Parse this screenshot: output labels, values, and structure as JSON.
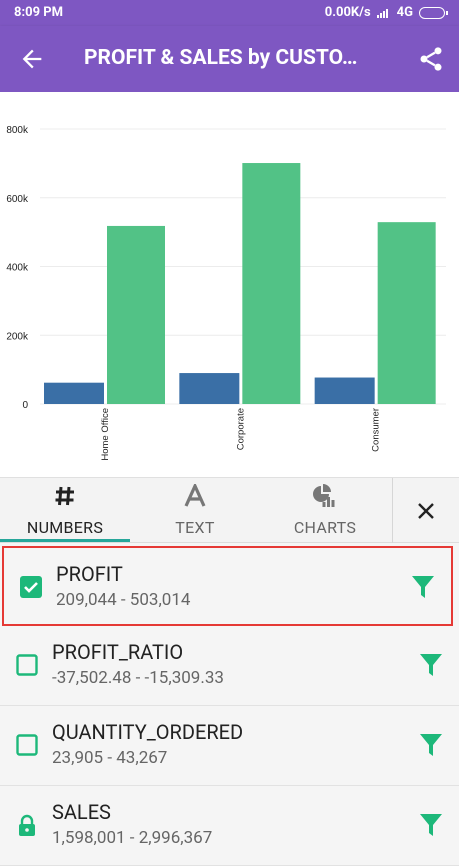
{
  "status_bar": {
    "time": "8:09 PM",
    "network_speed": "0.00K/s",
    "network_type": "4G"
  },
  "app_bar": {
    "title": "PROFIT & SALES by CUSTO…"
  },
  "chart_data": {
    "type": "bar",
    "categories": [
      "Home Office",
      "Corporate",
      "Consumer"
    ],
    "series": [
      {
        "color": "#3a6fa6",
        "values": [
          62000,
          90000,
          77000
        ]
      },
      {
        "color": "#52c286",
        "values": [
          518000,
          701000,
          529000
        ]
      }
    ],
    "ylim": [
      0,
      800000
    ],
    "yticks": [
      "0",
      "200k",
      "400k",
      "600k",
      "800k"
    ],
    "ytick_values": [
      0,
      200000,
      400000,
      600000,
      800000
    ],
    "grid": true
  },
  "tabs": [
    {
      "label": "NUMBERS",
      "icon": "hash-icon",
      "active": true
    },
    {
      "label": "TEXT",
      "icon": "text-a-icon",
      "active": false
    },
    {
      "label": "CHARTS",
      "icon": "pie-bar-chart-icon",
      "active": false
    }
  ],
  "fields": [
    {
      "name": "PROFIT",
      "range": "209,044 - 503,014",
      "state": "checked"
    },
    {
      "name": "PROFIT_RATIO",
      "range": "-37,502.48 - -15,309.33",
      "state": "unchecked"
    },
    {
      "name": "QUANTITY_ORDERED",
      "range": "23,905 - 43,267",
      "state": "unchecked"
    },
    {
      "name": "SALES",
      "range": "1,598,001 - 2,996,367",
      "state": "locked"
    }
  ],
  "colors": {
    "primary": "#7e57c2",
    "accent": "#26a69a",
    "filter": "#1db87a",
    "selection_border": "#e53935"
  }
}
